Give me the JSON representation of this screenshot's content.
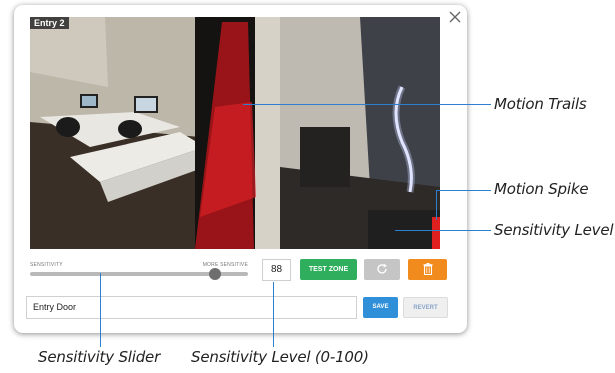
{
  "camera": {
    "label": "Entry 2"
  },
  "controls": {
    "sensitivity_label": "SENSITIVITY",
    "more_sensitive_label": "MORE SENSITIVE",
    "sensitivity_slider_fraction": 0.85,
    "sensitivity_level": "88",
    "test_zone_label": "TEST ZONE",
    "reset_icon": "refresh-icon",
    "delete_icon": "trash-icon"
  },
  "zone": {
    "name_value": "Entry Door",
    "save_label": "SAVE",
    "revert_label": "REVERT"
  },
  "callouts": {
    "motion_trails": "Motion Trails",
    "motion_spike": "Motion Spike",
    "sensitivity_level": "Sensitivity Level",
    "sensitivity_slider": "Sensitivity Slider",
    "sensitivity_level_range": "Sensitivity Level (0-100)"
  },
  "colors": {
    "test_zone": "#2fae5e",
    "delete": "#f28b1d",
    "save": "#2f8fd8",
    "motion": "#e0201f",
    "callout_line": "#2f7fd0"
  }
}
